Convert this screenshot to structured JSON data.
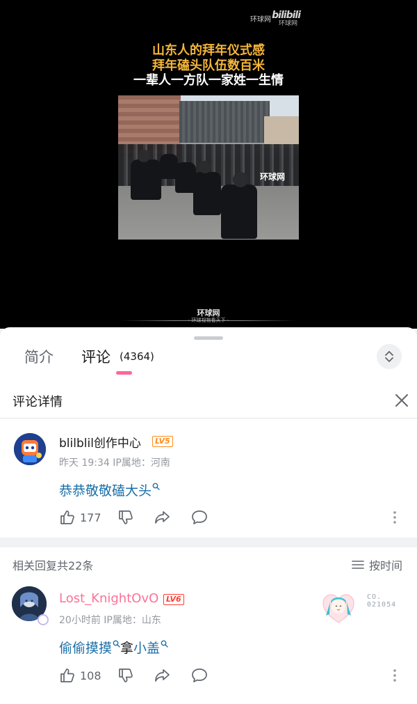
{
  "video": {
    "watermark_top": "环球网",
    "watermark_bili": "bilibili",
    "watermark_bili_sub": "环球网",
    "headline": [
      "山东人的拜年仪式感",
      "拜年磕头队伍数百米",
      "一辈人一方队一家姓一生情"
    ],
    "frame_watermark": "环球网",
    "bottom_watermark": "环球网",
    "bottom_watermark_sub": "· 环球视物看天下 ·"
  },
  "tabs": [
    {
      "label": "简介",
      "active": false
    },
    {
      "label": "评论",
      "active": true,
      "count": "(4364)"
    }
  ],
  "detail": {
    "title": "评论详情"
  },
  "main_comment": {
    "username": "blilblil创作中心",
    "level": "LV5",
    "meta": "昨天 19:34 IP属地：河南",
    "text_keyword": "恭恭敬敬磕大头",
    "likes": "177"
  },
  "replies_header": {
    "total": "相关回复共22条",
    "sort_label": "按时间"
  },
  "reply": {
    "username": "Lost_KnightOvO",
    "level": "LV6",
    "meta": "20小时前 IP属地：山东",
    "text_kw1": "偷偷摸摸",
    "text_plain": "拿",
    "text_kw2": "小盖",
    "likes": "108",
    "fan_no_line1": "CO.",
    "fan_no_line2": "021054"
  },
  "colors": {
    "accent_pink": "#fb7299",
    "underline": "#ff6699",
    "keyword_blue": "#1a6fa8",
    "lv_orange": "#ff8c1a",
    "headline_gold": "#f5b63a"
  }
}
